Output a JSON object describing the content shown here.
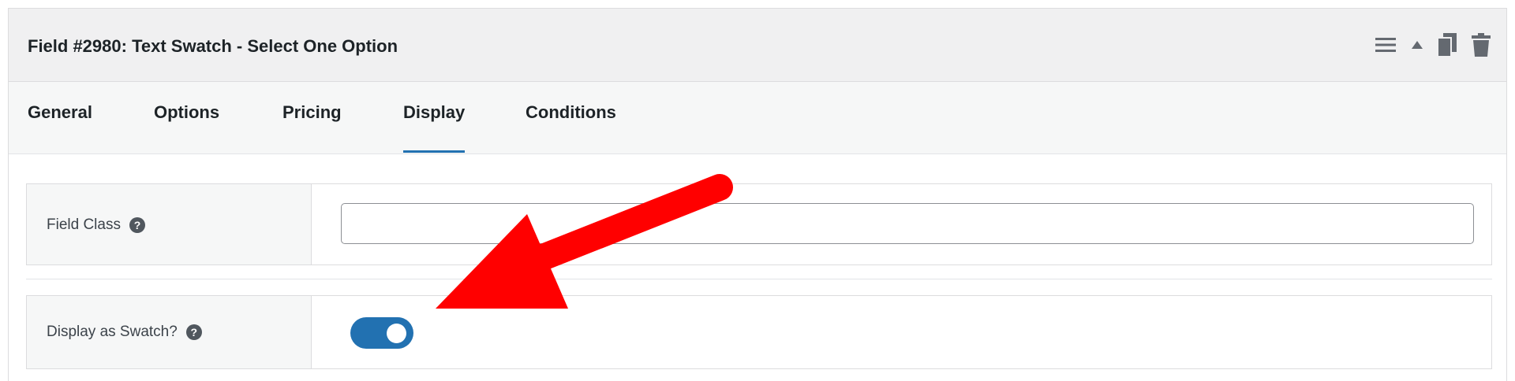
{
  "header": {
    "title": "Field #2980: Text Swatch - Select One Option",
    "actions": [
      {
        "icon": "menu-icon"
      },
      {
        "icon": "caret-up-icon"
      },
      {
        "icon": "copy-icon"
      },
      {
        "icon": "trash-icon"
      }
    ]
  },
  "tabs": [
    {
      "label": "General",
      "active": false
    },
    {
      "label": "Options",
      "active": false
    },
    {
      "label": "Pricing",
      "active": false
    },
    {
      "label": "Display",
      "active": true
    },
    {
      "label": "Conditions",
      "active": false
    }
  ],
  "fields": {
    "field_class": {
      "label": "Field Class",
      "help": "?",
      "value": ""
    },
    "display_as_swatch": {
      "label": "Display as Swatch?",
      "help": "?",
      "enabled": true
    }
  },
  "annotation": {
    "color": "#ff0000"
  },
  "colors": {
    "accent": "#2271b1",
    "header_bg": "#f0f0f1",
    "icon_gray": "#50575e"
  }
}
